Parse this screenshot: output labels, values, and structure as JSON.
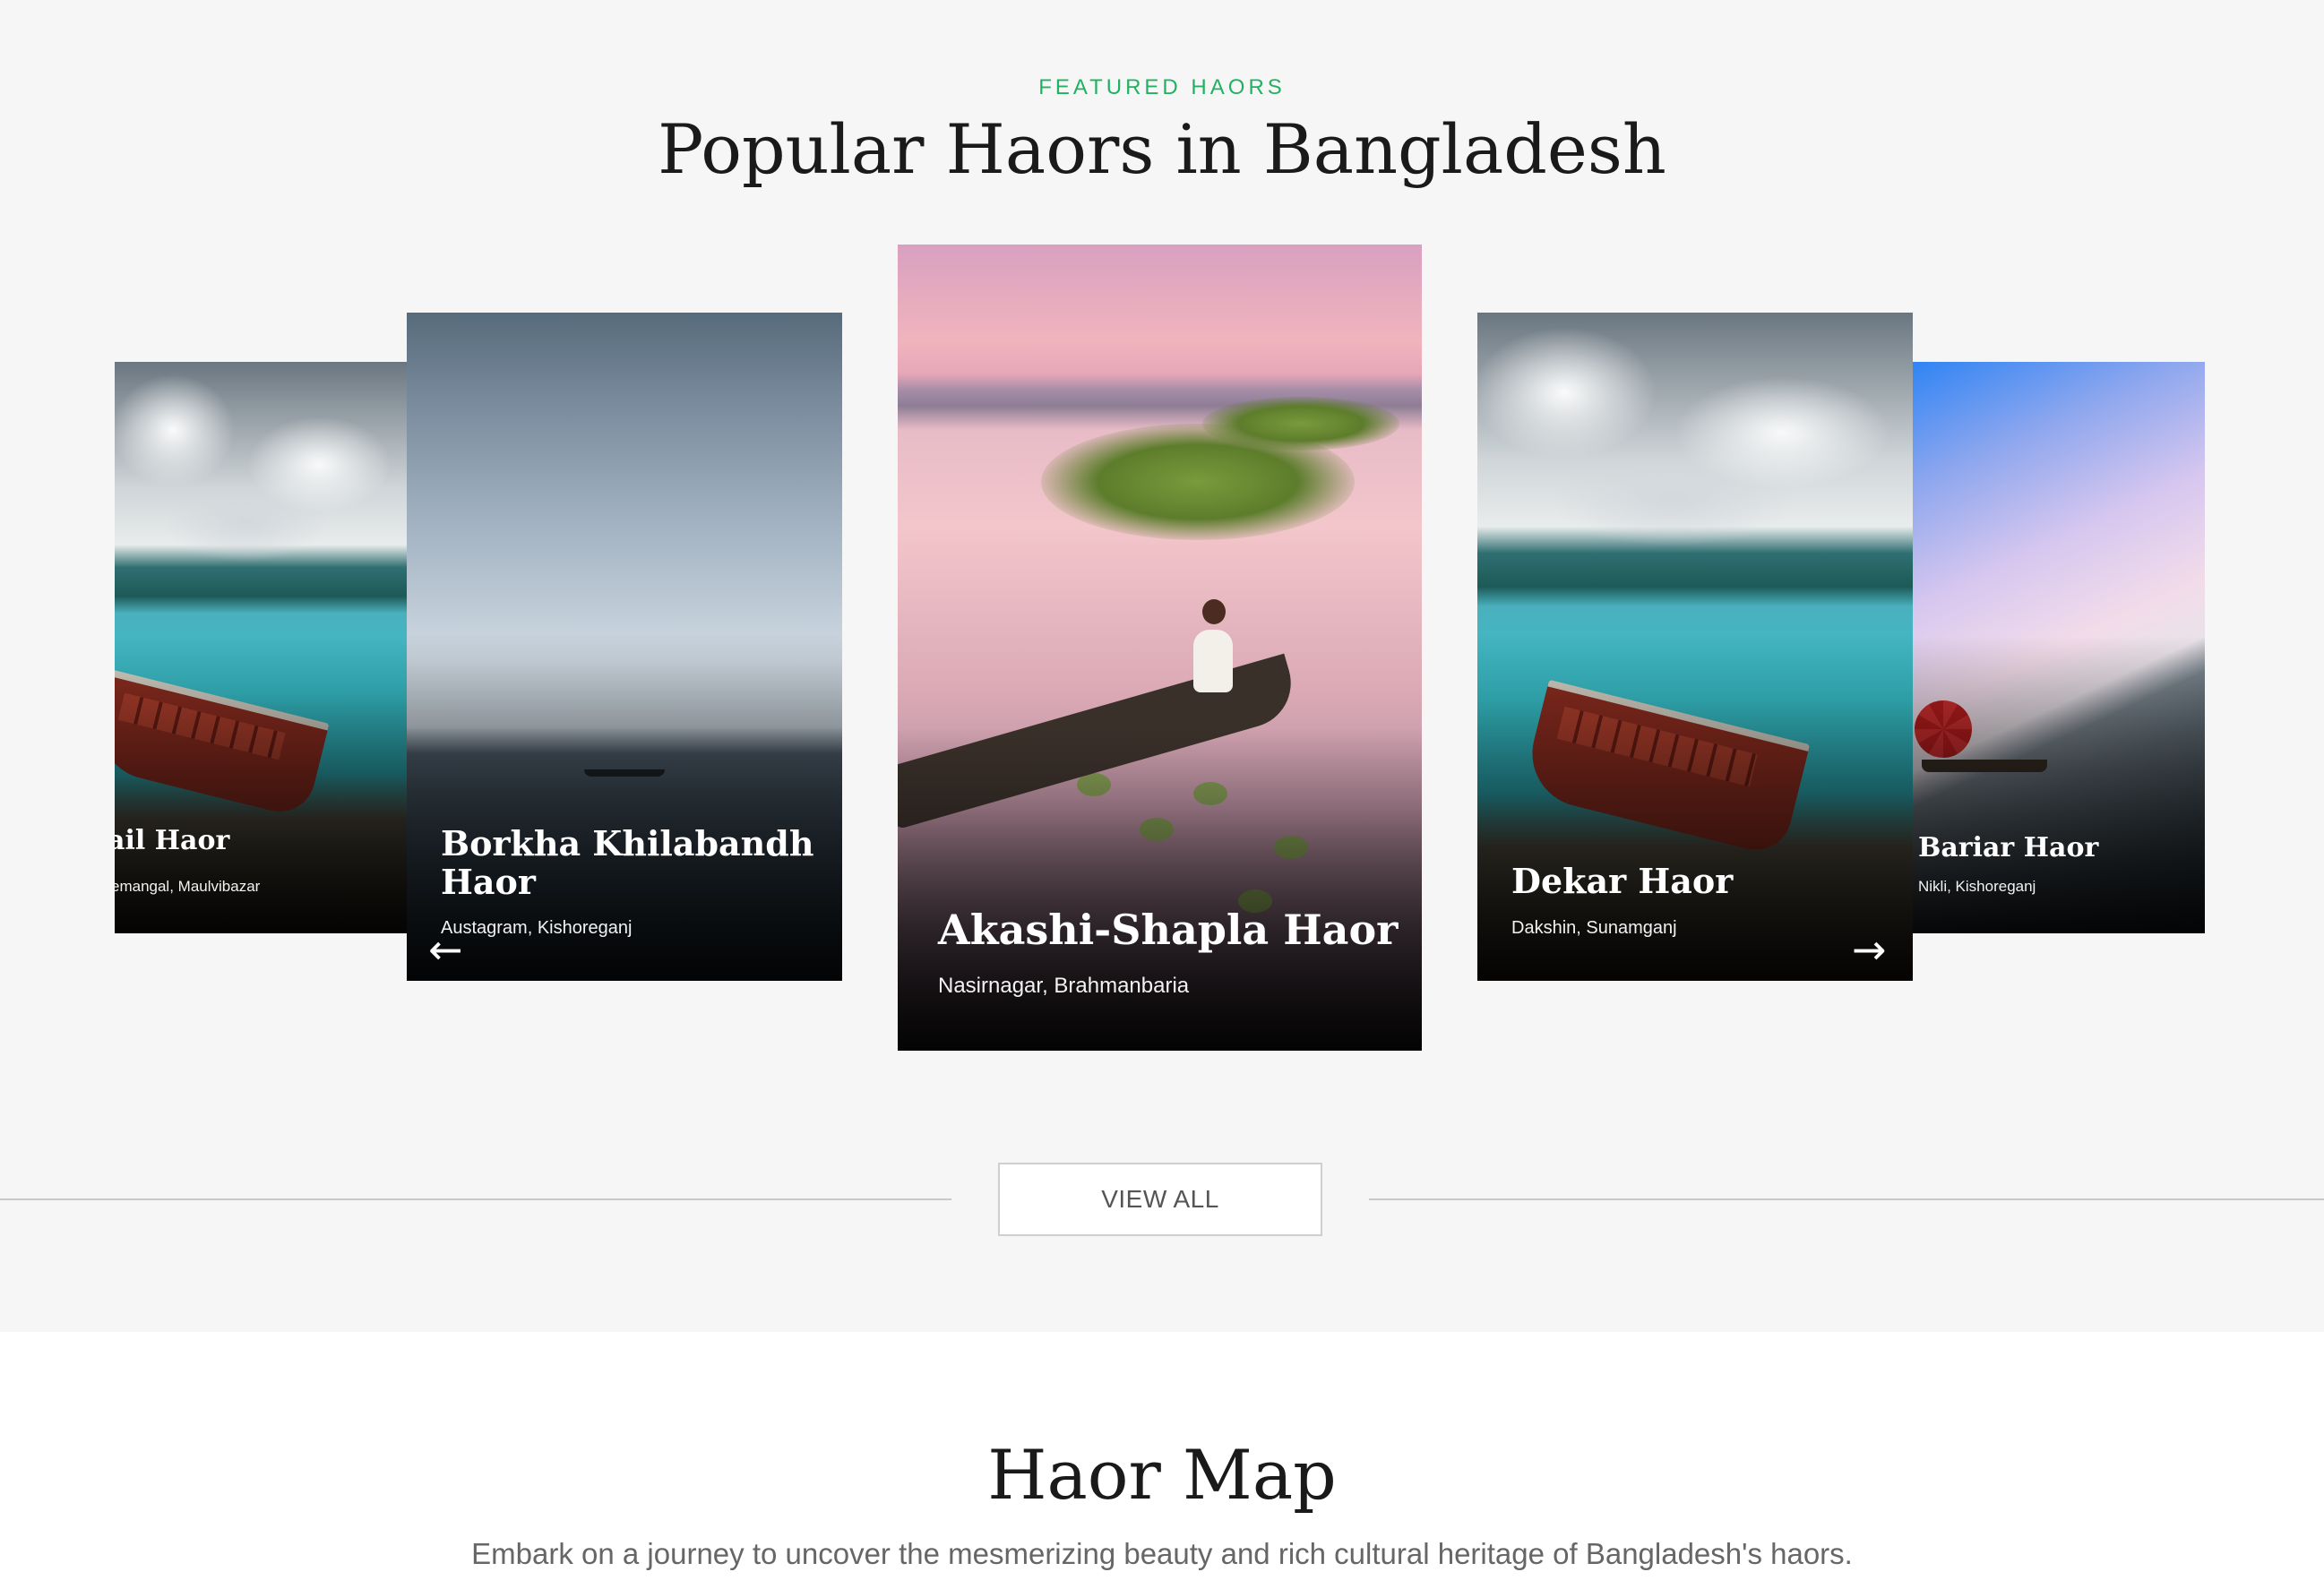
{
  "featured": {
    "eyebrow": "FEATURED HAORS",
    "title": "Popular Haors in Bangladesh",
    "cards": [
      {
        "name": "ail Haor",
        "location": "emangal, Maulvibazar"
      },
      {
        "name": "Borkha Khilabandh Haor",
        "location": "Austagram, Kishoreganj"
      },
      {
        "name": "Akashi-Shapla Haor",
        "location": "Nasirnagar, Brahmanbaria"
      },
      {
        "name": "Dekar Haor",
        "location": "Dakshin, Sunamganj"
      },
      {
        "name": "Bariar Haor",
        "location": "Nikli, Kishoreganj"
      }
    ],
    "prev_icon": "arrow-left-icon",
    "next_icon": "arrow-right-icon",
    "view_all_label": "VIEW ALL",
    "accent_color": "#22b163"
  },
  "map_section": {
    "title": "Haor Map",
    "subtitle": "Embark on a journey to uncover the mesmerizing beauty and rich cultural heritage of Bangladesh's haors."
  }
}
